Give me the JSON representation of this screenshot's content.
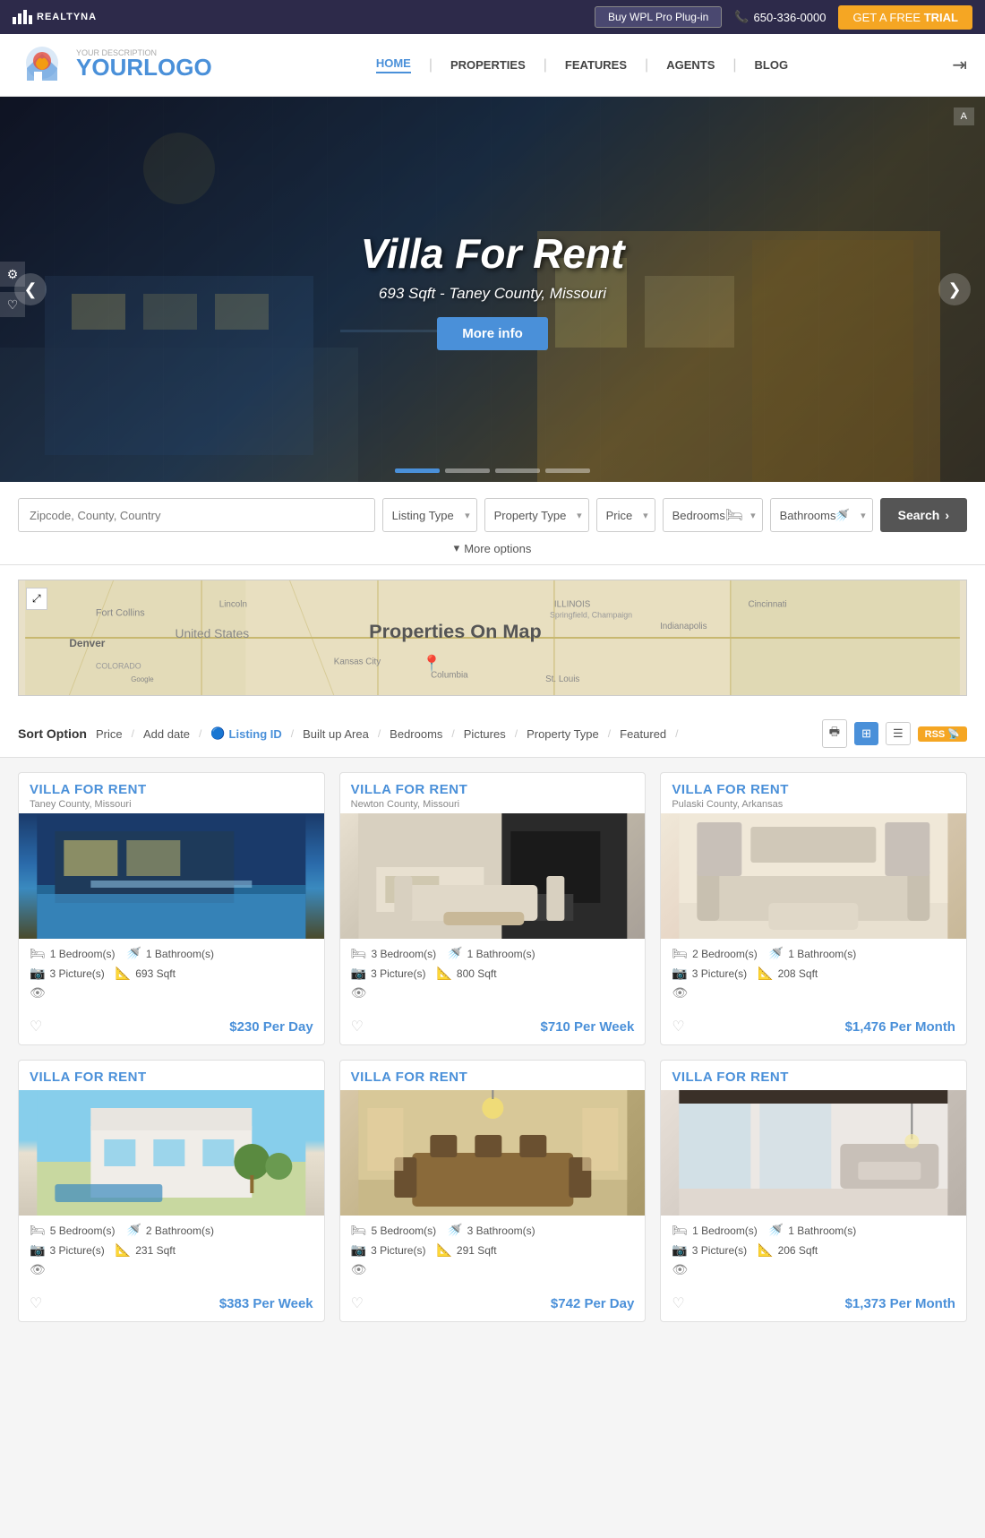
{
  "topbar": {
    "logo_bars": "REALTYNA",
    "buy_btn": "Buy WPL Pro Plug-in",
    "phone_icon": "📞",
    "phone": "650-336-0000",
    "trial_prefix": "GET A FREE",
    "trial_suffix": "TRIAL"
  },
  "header": {
    "logo_sub": "YOUR DESCRIPTION",
    "logo_text": "YOURLOGO",
    "nav": [
      {
        "label": "HOME",
        "active": true
      },
      {
        "label": "PROPERTIES",
        "active": false
      },
      {
        "label": "FEATURES",
        "active": false
      },
      {
        "label": "AGENTS",
        "active": false
      },
      {
        "label": "BLOG",
        "active": false
      }
    ]
  },
  "hero": {
    "title": "Villa For Rent",
    "subtitle": "693 Sqft - Taney County, Missouri",
    "btn": "More info",
    "left_arrow": "❮",
    "right_arrow": "❯",
    "dots": [
      true,
      false,
      false,
      false
    ],
    "map_btn": "A"
  },
  "search": {
    "placeholder": "Zipcode, County, Country",
    "listing_type": "Listing Type",
    "property_type": "Property Type",
    "price": "Price",
    "bedrooms": "Bedrooms",
    "bathrooms": "Bathrooms",
    "search_btn": "Search",
    "more_options": "More options"
  },
  "map": {
    "title": "Properties On Map",
    "expand_icon": "⤢",
    "google_label": "Google",
    "colorado_label": "COLORADO"
  },
  "sort": {
    "label": "Sort Option",
    "items": [
      {
        "label": "Price",
        "active": false
      },
      {
        "label": "Add date",
        "active": false
      },
      {
        "label": "Listing ID",
        "active": true
      },
      {
        "label": "Built up Area",
        "active": false
      },
      {
        "label": "Bedrooms",
        "active": false
      },
      {
        "label": "Pictures",
        "active": false
      },
      {
        "label": "Property Type",
        "active": false
      },
      {
        "label": "Featured",
        "active": false
      }
    ],
    "view_print": "🖶",
    "view_grid": "⊞",
    "view_list": "☰",
    "rss": "RSS"
  },
  "listings": [
    {
      "title": "VILLA FOR RENT",
      "location": "Taney County, Missouri",
      "img_class": "img-pool",
      "bedrooms": "1 Bedroom(s)",
      "bathrooms": "1 Bathroom(s)",
      "pictures": "3 Picture(s)",
      "sqft": "693 Sqft",
      "price": "$230 Per Day"
    },
    {
      "title": "VILLA FOR RENT",
      "location": "Newton County, Missouri",
      "img_class": "img-living",
      "bedrooms": "3 Bedroom(s)",
      "bathrooms": "1 Bathroom(s)",
      "pictures": "3 Picture(s)",
      "sqft": "800 Sqft",
      "price": "$710 Per Week"
    },
    {
      "title": "VILLA FOR RENT",
      "location": "Pulaski County, Arkansas",
      "img_class": "img-room",
      "bedrooms": "2 Bedroom(s)",
      "bathrooms": "1 Bathroom(s)",
      "pictures": "3 Picture(s)",
      "sqft": "208 Sqft",
      "price": "$1,476 Per Month"
    },
    {
      "title": "VILLA FOR RENT",
      "location": "",
      "img_class": "img-villa",
      "bedrooms": "5 Bedroom(s)",
      "bathrooms": "2 Bathroom(s)",
      "pictures": "3 Picture(s)",
      "sqft": "231 Sqft",
      "price": "$383 Per Week"
    },
    {
      "title": "VILLA FOR RENT",
      "location": "",
      "img_class": "img-dining",
      "bedrooms": "5 Bedroom(s)",
      "bathrooms": "3 Bathroom(s)",
      "pictures": "3 Picture(s)",
      "sqft": "291 Sqft",
      "price": "$742 Per Day"
    },
    {
      "title": "VILLA FOR RENT",
      "location": "",
      "img_class": "img-modern",
      "bedrooms": "1 Bedroom(s)",
      "bathrooms": "1 Bathroom(s)",
      "pictures": "3 Picture(s)",
      "sqft": "206 Sqft",
      "price": "$1,373 Per Month"
    }
  ]
}
